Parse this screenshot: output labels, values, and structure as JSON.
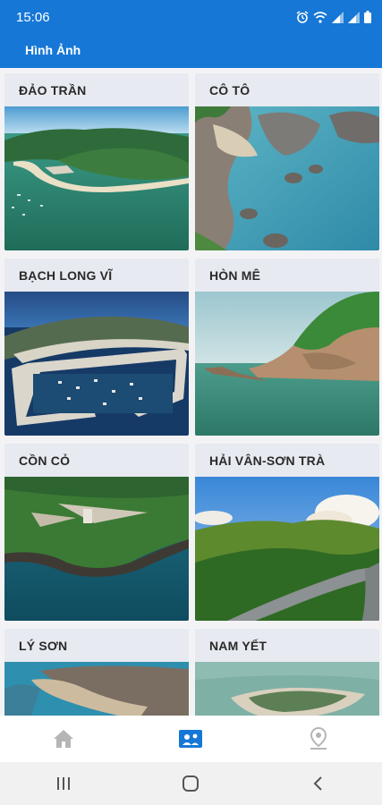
{
  "status": {
    "time": "15:06"
  },
  "appbar": {
    "title": "Hình Ảnh"
  },
  "cards": [
    {
      "title": "ĐẢO TRẦN"
    },
    {
      "title": "CÔ TÔ"
    },
    {
      "title": "BẠCH LONG VĨ"
    },
    {
      "title": "HÒN MÊ"
    },
    {
      "title": "CỒN CỎ"
    },
    {
      "title": "HẢI VÂN-SƠN TRÀ"
    },
    {
      "title": "LÝ SƠN"
    },
    {
      "title": "NAM YẾT"
    }
  ],
  "bottom_nav": {
    "items": [
      {
        "icon": "home-icon",
        "active": false
      },
      {
        "icon": "gallery-icon",
        "active": true
      },
      {
        "icon": "location-pin-icon",
        "active": false
      }
    ],
    "active_color": "#1677d6",
    "inactive_color": "#b5b5b5"
  }
}
